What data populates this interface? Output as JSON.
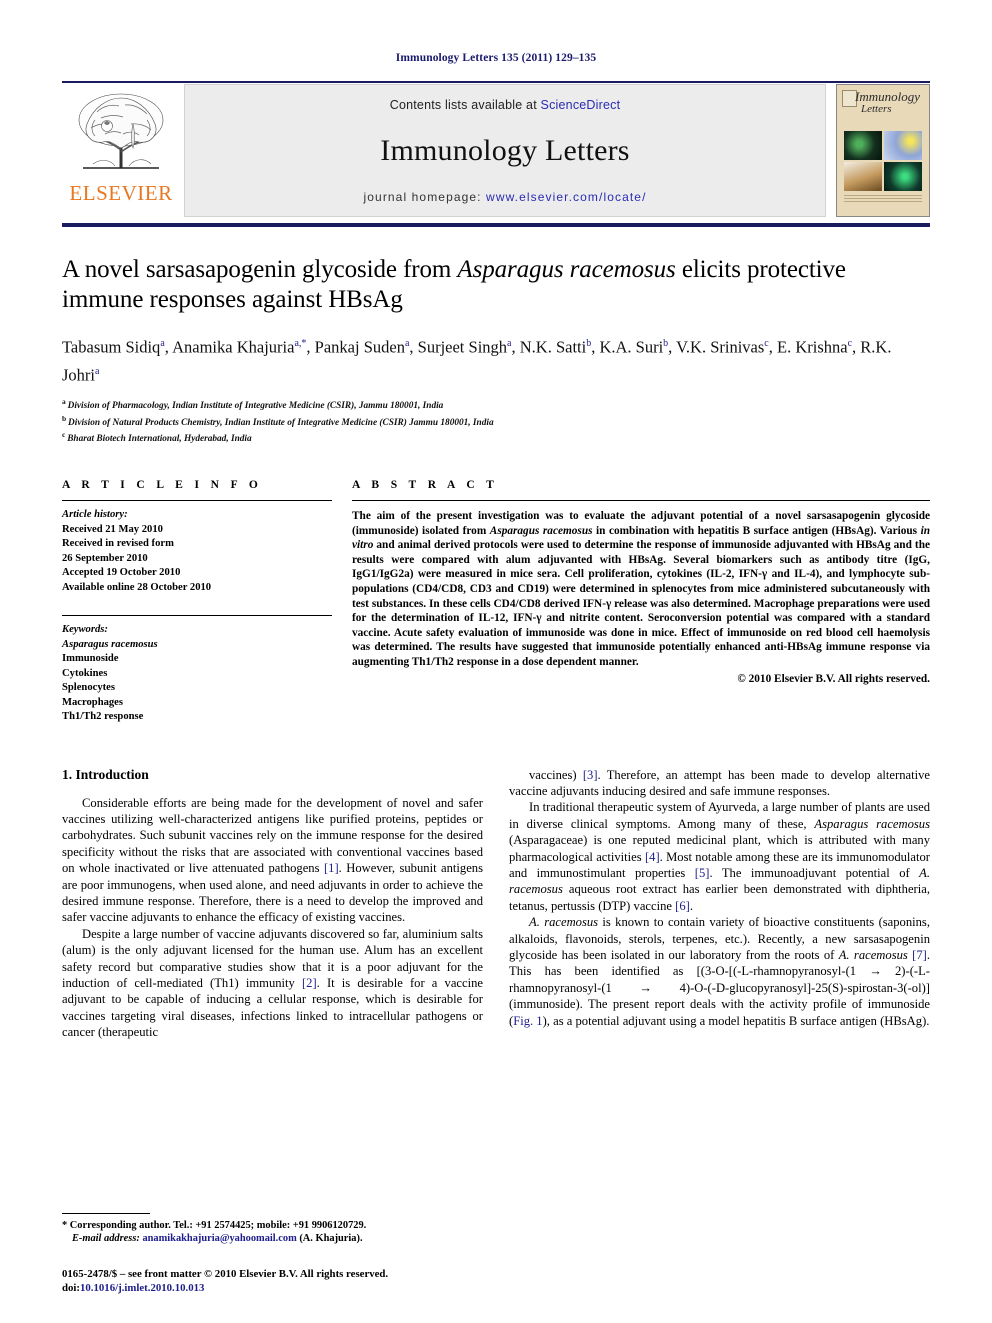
{
  "running_head": "Immunology Letters 135 (2011) 129–135",
  "masthead": {
    "contents_prefix": "Contents lists available at ",
    "sciencedirect": "ScienceDirect",
    "journal_name": "Immunology Letters",
    "homepage_prefix": "journal homepage: ",
    "homepage_url": "www.elsevier.com/locate/",
    "publisher": "ELSEVIER",
    "cover_title_line1": "Immunology",
    "cover_title_line2": "Letters"
  },
  "title": "A novel sarsasapogenin glycoside from Asparagus racemosus elicits protective immune responses against HBsAg",
  "title_parts": {
    "p1": "A novel sarsasapogenin glycoside from ",
    "italic": "Asparagus racemosus",
    "p2": " elicits protective immune responses against HBsAg"
  },
  "authors_line1": "Tabasum Sidiq",
  "authors": [
    {
      "name": "Tabasum Sidiq",
      "sup": "a"
    },
    {
      "name": "Anamika Khajuria",
      "sup": "a,*"
    },
    {
      "name": "Pankaj Suden",
      "sup": "a"
    },
    {
      "name": "Surjeet Singh",
      "sup": "a"
    },
    {
      "name": "N.K. Satti",
      "sup": "b"
    },
    {
      "name": "K.A. Suri",
      "sup": "b"
    },
    {
      "name": "V.K. Srinivas",
      "sup": "c"
    },
    {
      "name": "E. Krishna",
      "sup": "c"
    },
    {
      "name": "R.K. Johri",
      "sup": "a"
    }
  ],
  "affiliations": [
    {
      "sup": "a",
      "text": "Division of Pharmacology, Indian Institute of Integrative Medicine (CSIR), Jammu 180001, India"
    },
    {
      "sup": "b",
      "text": "Division of Natural Products Chemistry, Indian Institute of Integrative Medicine (CSIR) Jammu 180001, India"
    },
    {
      "sup": "c",
      "text": "Bharat Biotech International, Hyderabad, India"
    }
  ],
  "article_info": {
    "heading": "A R T I C L E    I N F O",
    "history_label": "Article history:",
    "history": [
      "Received 21 May 2010",
      "Received in revised form",
      "26 September 2010",
      "Accepted 19 October 2010",
      "Available online 28 October 2010"
    ],
    "keywords_label": "Keywords:",
    "keywords": [
      {
        "text": "Asparagus racemosus",
        "italic": true
      },
      {
        "text": "Immunoside",
        "italic": false
      },
      {
        "text": "Cytokines",
        "italic": false
      },
      {
        "text": "Splenocytes",
        "italic": false
      },
      {
        "text": "Macrophages",
        "italic": false
      },
      {
        "text": "Th1/Th2 response",
        "italic": false
      }
    ]
  },
  "abstract": {
    "heading": "A B S T R A C T",
    "segments": [
      {
        "t": "The aim of the present investigation was to evaluate the adjuvant potential of a novel sarsasapogenin glycoside (immunoside) isolated from ",
        "i": false
      },
      {
        "t": "Asparagus racemosus",
        "i": true
      },
      {
        "t": " in combination with hepatitis B surface antigen (HBsAg). Various ",
        "i": false
      },
      {
        "t": "in vitro",
        "i": true
      },
      {
        "t": " and animal derived protocols were used to determine the response of immunoside adjuvanted with HBsAg and the results were compared with alum adjuvanted with HBsAg. Several biomarkers such as antibody titre (IgG, IgG1/IgG2a) were measured in mice sera. Cell proliferation, cytokines (IL-2, IFN-γ and IL-4), and lymphocyte sub-populations (CD4/CD8, CD3 and CD19) were determined in splenocytes from mice administered subcutaneously with test substances. In these cells CD4/CD8 derived IFN-γ release was also determined. Macrophage preparations were used for the determination of IL-12, IFN-γ and nitrite content. Seroconversion potential was compared with a standard vaccine. Acute safety evaluation of immunoside was done in mice. Effect of immunoside on red blood cell haemolysis was determined. The results have suggested that immunoside potentially enhanced anti-HBsAg immune response via augmenting Th1/Th2 response in a dose dependent manner.",
        "i": false
      }
    ],
    "copyright": "© 2010 Elsevier B.V. All rights reserved."
  },
  "introduction": {
    "heading": "1.  Introduction",
    "left_paragraphs": [
      [
        {
          "t": "Considerable efforts are being made for the development of novel and safer vaccines utilizing well-characterized antigens like purified proteins, peptides or carbohydrates. Such subunit vaccines rely on the immune response for the desired specificity without the risks that are associated with conventional vaccines based on whole inactivated or live attenuated pathogens ",
          "k": "n"
        },
        {
          "t": "[1]",
          "k": "r"
        },
        {
          "t": ". However, subunit antigens are poor immunogens, when used alone, and need adjuvants in order to achieve the desired immune response. Therefore, there is a need to develop the improved and safer vaccine adjuvants to enhance the efficacy of existing vaccines.",
          "k": "n"
        }
      ],
      [
        {
          "t": "Despite a large number of vaccine adjuvants discovered so far, aluminium salts (alum) is the only adjuvant licensed for the human use. Alum has an excellent safety record but comparative studies show that it is a poor adjuvant for the induction of cell-mediated (Th1) immunity ",
          "k": "n"
        },
        {
          "t": "[2]",
          "k": "r"
        },
        {
          "t": ". It is desirable for a vaccine adjuvant to be capable of inducing a cellular response, which is desirable for vaccines targeting viral diseases, infections linked to intracellular pathogens or cancer (therapeutic",
          "k": "n"
        }
      ]
    ],
    "right_paragraphs": [
      [
        {
          "t": "vaccines) ",
          "k": "n"
        },
        {
          "t": "[3]",
          "k": "r"
        },
        {
          "t": ". Therefore, an attempt has been made to develop alternative vaccine adjuvants inducing desired and safe immune responses.",
          "k": "n"
        }
      ],
      [
        {
          "t": "In traditional therapeutic system of Ayurveda, a large number of plants are used in diverse clinical symptoms. Among many of these, ",
          "k": "n"
        },
        {
          "t": "Asparagus racemosus",
          "k": "i"
        },
        {
          "t": " (Asparagaceae) is one reputed medicinal plant, which is attributed with many pharmacological activities ",
          "k": "n"
        },
        {
          "t": "[4]",
          "k": "r"
        },
        {
          "t": ". Most notable among these are its immunomodulator and immunostimulant properties ",
          "k": "n"
        },
        {
          "t": "[5]",
          "k": "r"
        },
        {
          "t": ". The immunoadjuvant potential of ",
          "k": "n"
        },
        {
          "t": "A. racemosus",
          "k": "i"
        },
        {
          "t": " aqueous root extract has earlier been demonstrated with diphtheria, tetanus, pertussis (DTP) vaccine ",
          "k": "n"
        },
        {
          "t": "[6]",
          "k": "r"
        },
        {
          "t": ".",
          "k": "n"
        }
      ],
      [
        {
          "t": "A. racemosus",
          "k": "i"
        },
        {
          "t": " is known to contain variety of bioactive constituents (saponins, alkaloids, flavonoids, sterols, terpenes, etc.). Recently, a new sarsasapogenin glycoside has been isolated in our laboratory from the roots of ",
          "k": "n"
        },
        {
          "t": "A. racemosus",
          "k": "i"
        },
        {
          "t": " ",
          "k": "n"
        },
        {
          "t": "[7]",
          "k": "r"
        },
        {
          "t": ". This has been identified as [(3-O-[(-",
          "k": "n"
        },
        {
          "t": "L",
          "k": "sc"
        },
        {
          "t": "-rhamnopyranosyl-(1 → 2)-(-",
          "k": "n"
        },
        {
          "t": "L",
          "k": "sc"
        },
        {
          "t": "-rhamnopyranosyl-(1 → 4)-O-(-",
          "k": "n"
        },
        {
          "t": "D",
          "k": "sc"
        },
        {
          "t": "-glucopyranosyl]-25(S)-spirostan-3(-ol)]   (immunoside). The present report deals with the activity profile of immunoside (",
          "k": "n"
        },
        {
          "t": "Fig. 1",
          "k": "r"
        },
        {
          "t": "), as a potential adjuvant using a model hepatitis B surface antigen (HBsAg).",
          "k": "n"
        }
      ]
    ]
  },
  "footnotes": {
    "corresponding_marker": "*",
    "corresponding": " Corresponding author. Tel.: +91 2574425; mobile: +91 9906120729.",
    "email_label": "E-mail address:",
    "email": "anamikakhajuria@yahoomail.com",
    "email_suffix": " (A. Khajuria).",
    "imprint_line1": "0165-2478/$ – see front matter © 2010 Elsevier B.V. All rights reserved.",
    "doi_label": "doi:",
    "doi": "10.1016/j.imlet.2010.10.013"
  },
  "colors": {
    "runhead": "#1a1a6e",
    "rule": "#1a1a5e",
    "link": "#2b2bb4",
    "reference": "#1d1d8c",
    "elsevier_orange": "#E87722",
    "masthead_bg": "#ececec"
  }
}
